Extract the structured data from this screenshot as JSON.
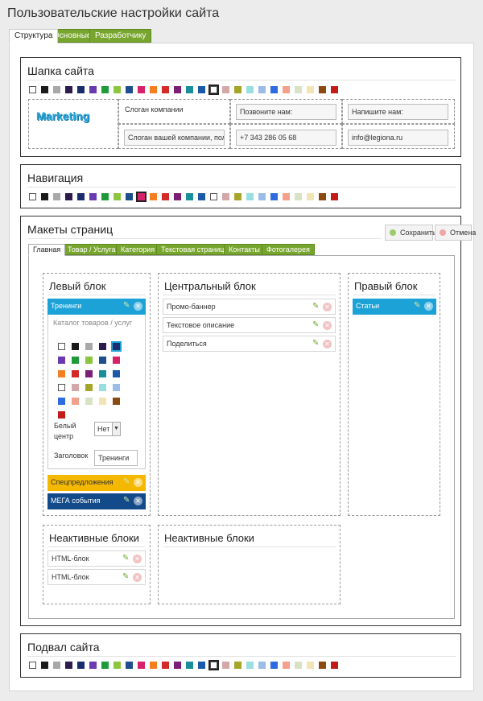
{
  "page_title": "Пользовательские настройки сайта",
  "top_tabs": [
    "Структура",
    "Основные",
    "Разработчику"
  ],
  "palette_colors": [
    "#ffffff",
    "#1a1a1a",
    "#a8a8a8",
    "#2d1b4e",
    "#1b2c6e",
    "#6a3ab0",
    "#1e9a3a",
    "#8cc63f",
    "#1f4e8c",
    "#d6226a",
    "#f47f20",
    "#d32a2a",
    "#7a1f75",
    "#1a8f9a",
    "#1b5aa8",
    "#ffffff",
    "#d4a8a8",
    "#a5a52a",
    "#9adfe0",
    "#9bbbe8",
    "#2f6be0",
    "#f3a08c",
    "#d8e2c4",
    "#f3e4b8",
    "#8a4a12",
    "#c41a1a"
  ],
  "header_section": {
    "title": "Шапка сайта",
    "logo_text": "Marketing",
    "slogan_label": "Слоган компании",
    "slogan_value": "Слоган вашей компании, поле мо",
    "call_label": "Позвоните нам:",
    "phone_value": "+7 343 286 05 68",
    "write_label": "Напишите нам:",
    "email_value": "info@legiona.ru"
  },
  "nav_section": {
    "title": "Навигация"
  },
  "layouts_section": {
    "title": "Макеты страниц",
    "save_label": "Сохранить",
    "cancel_label": "Отмена",
    "tabs": [
      "Главная",
      "Товар / Услуга",
      "Категория",
      "Текстовая страница",
      "Контакты",
      "Фотогалерея"
    ],
    "left_block": {
      "title": "Левый блок",
      "trainings": "Тренинги",
      "catalog_placeholder": "Каталог товаров / услуг",
      "white_center_label_1": "Белый",
      "white_center_label_2": "центр",
      "white_center_value": "Нет",
      "heading_label": "Заголовок",
      "heading_value": "Тренинги",
      "special_offers": "Спецпредложения",
      "mega_events": "МЕГА события"
    },
    "center_block": {
      "title": "Центральный блок",
      "items": [
        "Промо-баннер",
        "Текстовое описание",
        "Поделиться"
      ]
    },
    "right_block": {
      "title": "Правый блок",
      "articles": "Статьи"
    },
    "inactive_left": {
      "title": "Неактивные блоки",
      "items": [
        "HTML-блок",
        "HTML-блок"
      ]
    },
    "inactive_center": {
      "title": "Неактивные блоки"
    }
  },
  "footer_section": {
    "title": "Подвал сайта"
  },
  "colors": {
    "accent_green": "#78a52e",
    "trainings_blue": "#1da2d8",
    "special_yellow": "#f5b800",
    "mega_navy": "#124a8a",
    "articles_blue": "#1da2d8"
  }
}
